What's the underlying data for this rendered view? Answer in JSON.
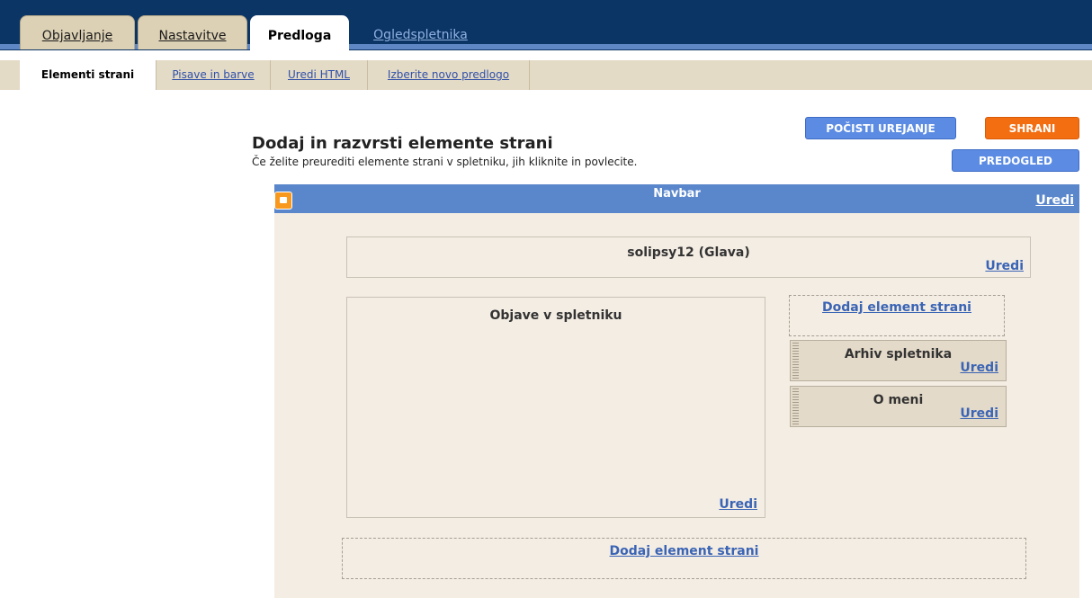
{
  "tabs": [
    {
      "label": "Objavljanje"
    },
    {
      "label": "Nastavitve"
    },
    {
      "label": "Predloga"
    },
    {
      "label": "Ogledspletnika"
    }
  ],
  "subtabs": [
    {
      "label": "Elementi strani"
    },
    {
      "label": "Pisave in barve"
    },
    {
      "label": "Uredi HTML"
    },
    {
      "label": "Izberite novo predlogo"
    }
  ],
  "page": {
    "title": "Dodaj in razvrsti elemente strani",
    "description": "Če želite preurediti elemente strani v spletniku, jih kliknite in povlecite."
  },
  "buttons": {
    "clear": "POČISTI UREJANJE",
    "save": "SHRANI",
    "preview": "PREDOGLED"
  },
  "colors": {
    "topbar": "#0b3565",
    "accent_blue": "#5b8be2",
    "save_orange": "#f36d11",
    "editor_bg": "#f4ede3"
  },
  "editor": {
    "navbar": {
      "title": "Navbar",
      "edit": "Uredi",
      "icon": "blogger-logo-icon"
    },
    "header": {
      "title": "solipsy12 (Glava)",
      "edit": "Uredi"
    },
    "posts": {
      "title": "Objave v spletniku",
      "edit": "Uredi"
    },
    "sidebar_add": "Dodaj element strani",
    "gadgets": [
      {
        "title": "Arhiv spletnika",
        "edit": "Uredi"
      },
      {
        "title": "O meni",
        "edit": "Uredi"
      }
    ],
    "footer_add": "Dodaj element strani"
  }
}
